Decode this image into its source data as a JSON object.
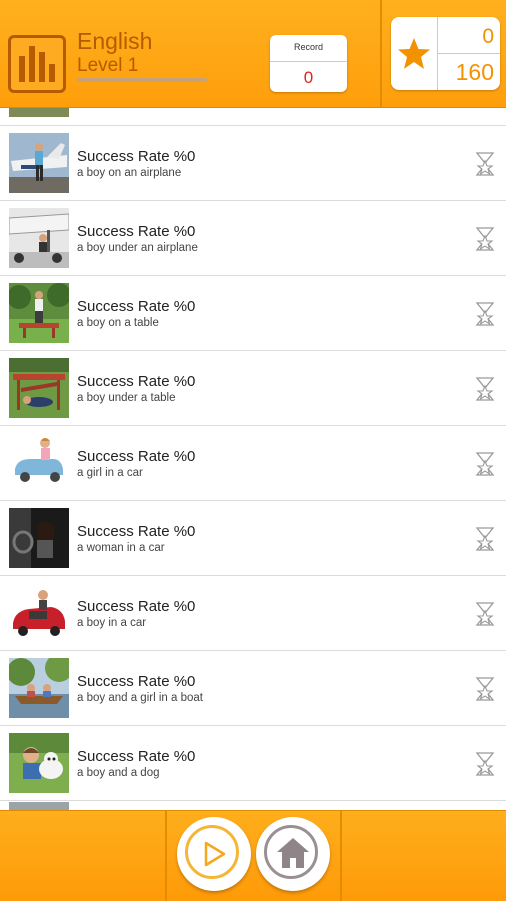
{
  "header": {
    "language": "English",
    "level": "Level 1",
    "level_progress": 0,
    "record_label": "Record",
    "record_value": "0",
    "stars_count": "0",
    "points": "160"
  },
  "items": [
    {
      "rate": "Success Rate %0",
      "caption": "a boy on an airplane",
      "thumb": "boy-on-airplane"
    },
    {
      "rate": "Success Rate %0",
      "caption": "a boy under an airplane",
      "thumb": "boy-under-airplane"
    },
    {
      "rate": "Success Rate %0",
      "caption": "a boy on a table",
      "thumb": "boy-on-table"
    },
    {
      "rate": "Success Rate %0",
      "caption": "a boy under a table",
      "thumb": "boy-under-table"
    },
    {
      "rate": "Success Rate %0",
      "caption": "a girl in a car",
      "thumb": "girl-in-car"
    },
    {
      "rate": "Success Rate %0",
      "caption": "a woman in a car",
      "thumb": "woman-in-car"
    },
    {
      "rate": "Success Rate %0",
      "caption": "a boy in a car",
      "thumb": "boy-in-car"
    },
    {
      "rate": "Success Rate %0",
      "caption": "a boy and a girl in a boat",
      "thumb": "boy-girl-boat"
    },
    {
      "rate": "Success Rate %0",
      "caption": "a boy and a dog",
      "thumb": "boy-and-dog"
    }
  ],
  "icons": {
    "logo": "bar-chart-icon",
    "score": "star-icon",
    "row_action": "hourglass-star-icon",
    "play": "play-icon",
    "home": "home-icon"
  },
  "colors": {
    "accent": "#ffa514",
    "text_brown": "#b55b00",
    "record_red": "#e2231a",
    "score_orange": "#f39200"
  }
}
